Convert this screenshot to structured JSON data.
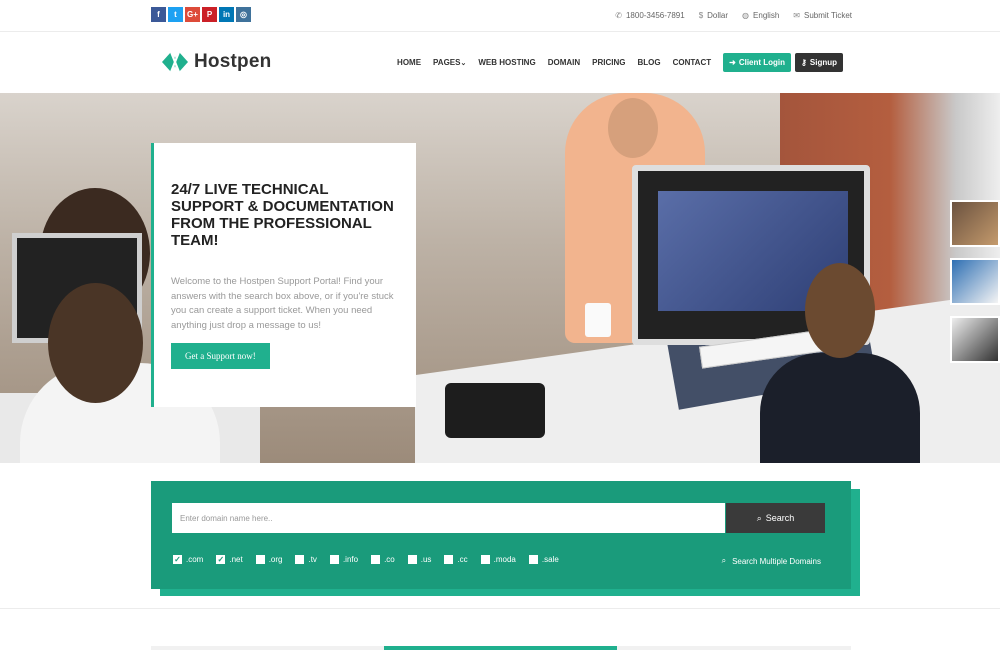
{
  "topbar": {
    "socials": [
      {
        "icon": "facebook-icon",
        "glyph": "f",
        "color": "#3b5998"
      },
      {
        "icon": "twitter-icon",
        "glyph": "t",
        "color": "#1da1f2"
      },
      {
        "icon": "googleplus-icon",
        "glyph": "G+",
        "color": "#dd4b39"
      },
      {
        "icon": "pinterest-icon",
        "glyph": "P",
        "color": "#cb2027"
      },
      {
        "icon": "linkedin-icon",
        "glyph": "in",
        "color": "#0077b5"
      },
      {
        "icon": "instagram-icon",
        "glyph": "◎",
        "color": "#3f729b"
      }
    ],
    "phone": "1800-3456-7891",
    "currency": "Dollar",
    "language": "English",
    "ticket": "Submit Ticket"
  },
  "header": {
    "logo_text": "Hostpen",
    "nav": [
      "HOME",
      "PAGES",
      "WEB HOSTING",
      "DOMAIN",
      "PRICING",
      "BLOG",
      "CONTACT"
    ],
    "login_label": "Client Login",
    "signup_label": "Signup"
  },
  "hero": {
    "title": "24/7 Live Technical Support & Documentation from the Professional Team!",
    "text": "Welcome to the Hostpen Support Portal! Find your answers with the search box above, or if you're stuck you can create a support ticket. When you need anything just drop a message to us!",
    "button_label": "Get a Support now!"
  },
  "domain": {
    "placeholder": "Enter domain name here..",
    "search_label": "Search",
    "tlds": [
      {
        "label": ".com",
        "checked": true
      },
      {
        "label": ".net",
        "checked": true
      },
      {
        "label": ".org",
        "checked": false
      },
      {
        "label": ".tv",
        "checked": false
      },
      {
        "label": ".info",
        "checked": false
      },
      {
        "label": ".co",
        "checked": false
      },
      {
        "label": ".us",
        "checked": false
      },
      {
        "label": ".cc",
        "checked": false
      },
      {
        "label": ".moda",
        "checked": false
      },
      {
        "label": ".sale",
        "checked": false
      }
    ],
    "multi_label": "Search Multiple Domains"
  },
  "colors": {
    "accent": "#20b08e",
    "domain_bg": "#1a9b7b",
    "dark": "#333333"
  }
}
